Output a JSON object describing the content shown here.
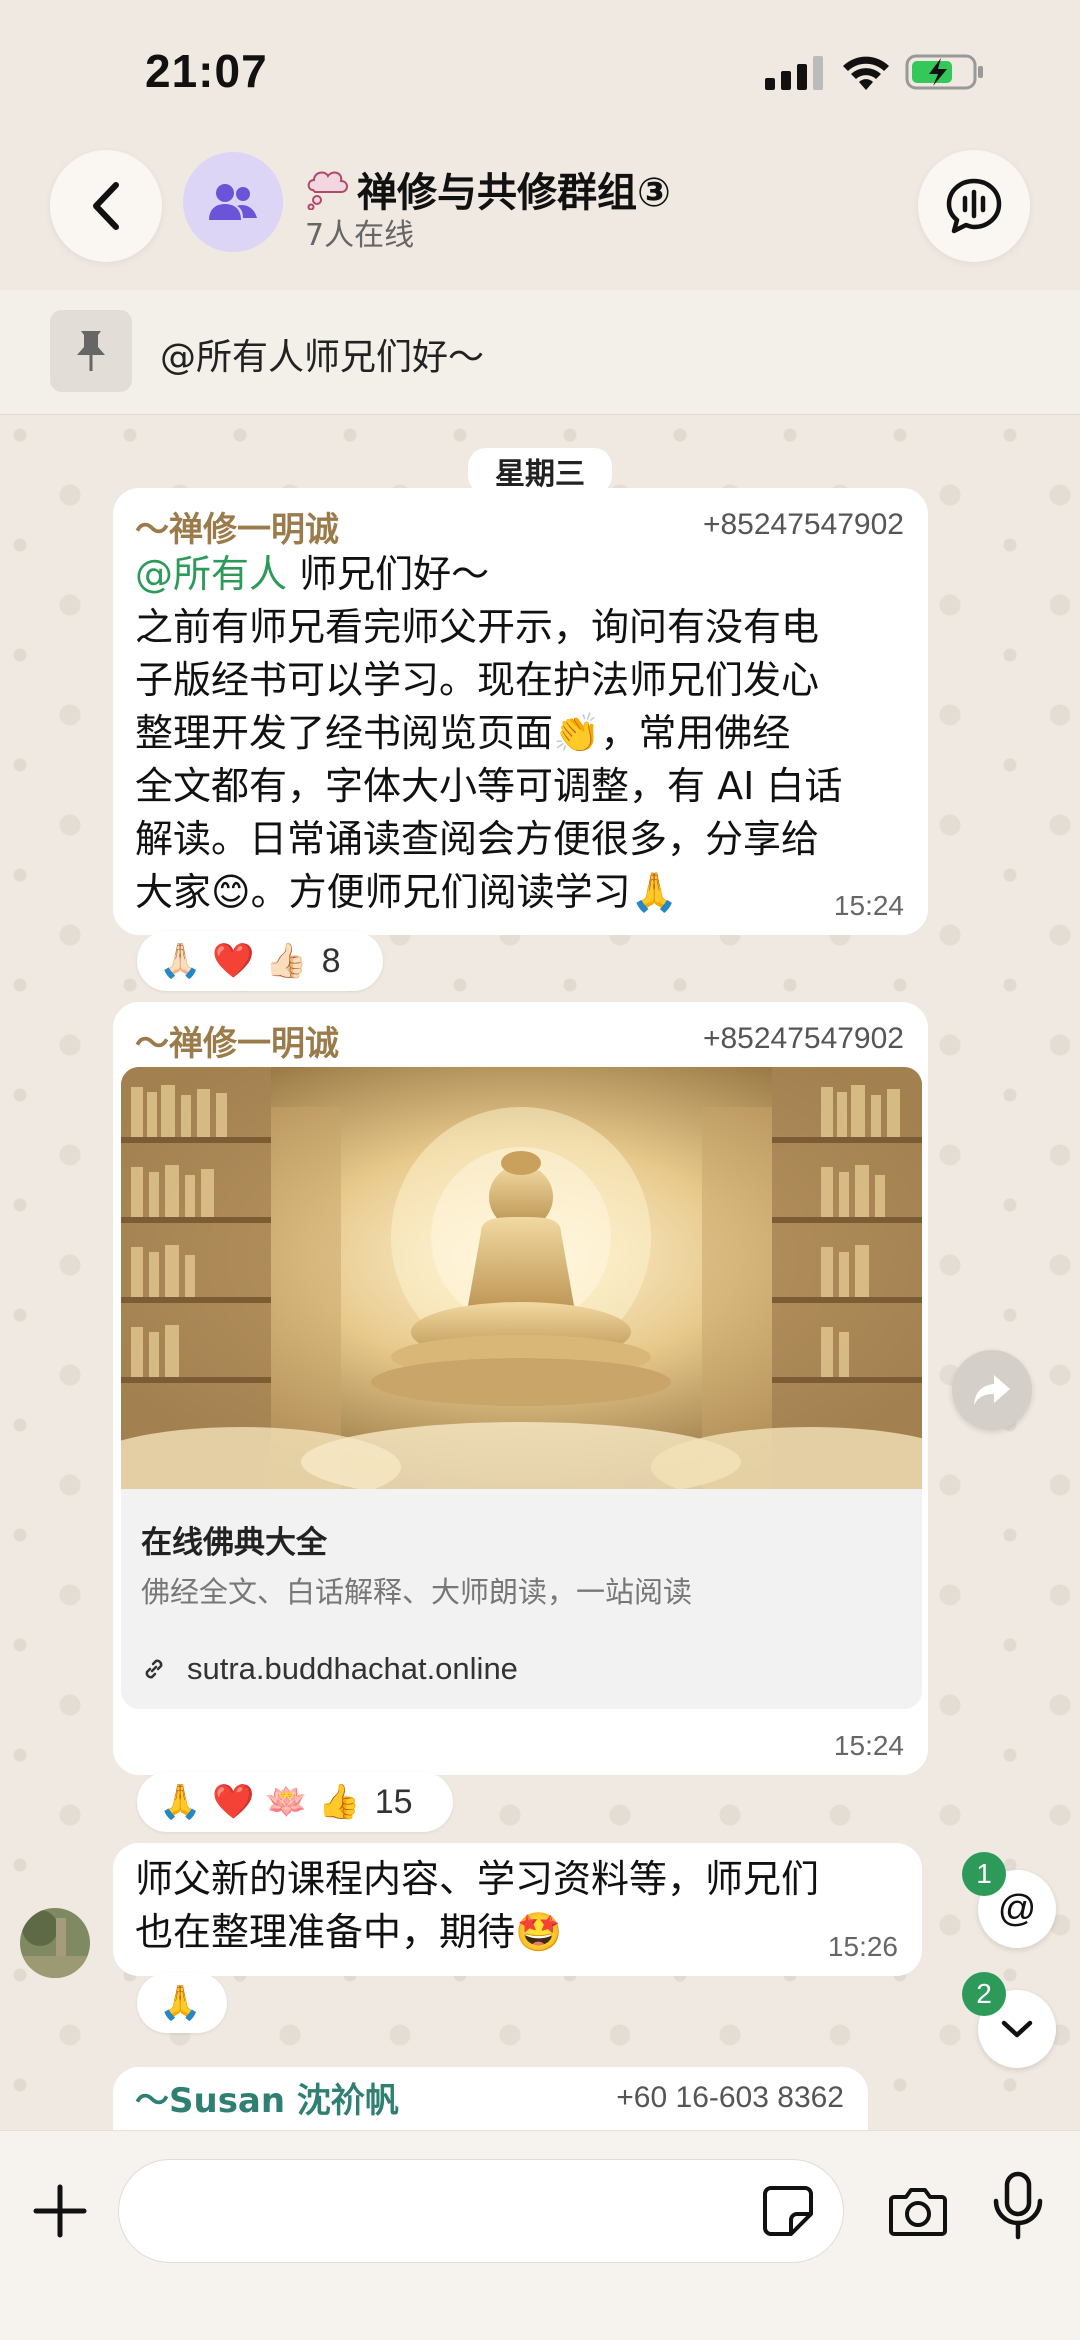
{
  "status_bar": {
    "time": "21:07"
  },
  "header": {
    "title": "禅修与共修群组③",
    "subtitle": "7人在线"
  },
  "pinned": {
    "text": "@所有人师兄们好～"
  },
  "day_label": "星期三",
  "messages": [
    {
      "sender": "～禅修一明诚",
      "phone": "+85247547902",
      "mention": "@所有人",
      "greeting": " 师兄们好～",
      "lines": [
        "之前有师兄看完师父开示，询问有没有电",
        "子版经书可以学习。现在护法师兄们发心",
        "整理开发了经书阅览页面👏，常用佛经",
        "全文都有，字体大小等可调整，有 AI 白话",
        "解读。日常诵读查阅会方便很多，分享给",
        "大家😊。方便师兄们阅读学习🙏"
      ],
      "time": "15:24",
      "reactions": {
        "emojis": "🙏🏻 ❤️ 👍🏻",
        "count": "8"
      }
    },
    {
      "sender": "～禅修一明诚",
      "phone": "+85247547902",
      "link_card": {
        "title": "在线佛典大全",
        "description": "佛经全文、白话解释、大师朗读，一站阅读",
        "url": "sutra.buddhachat.online"
      },
      "time": "15:24",
      "reactions": {
        "emojis": "🙏 ❤️ 🪷 👍",
        "count": "15"
      }
    },
    {
      "lines": [
        "师父新的课程内容、学习资料等，师兄们",
        "也在整理准备中，期待🤩"
      ],
      "time": "15:26",
      "reactions": {
        "emojis": "🙏"
      }
    },
    {
      "sender": "～Susan 沈祄帆",
      "phone": "+60 16-603 8362"
    }
  ],
  "side_buttons": {
    "mention_badge": "1",
    "mention_label": "@",
    "scroll_badge": "2"
  },
  "colors": {
    "accent_green": "#2e9a5a",
    "sender_gold": "#9b7b4a",
    "sender_teal": "#2f7f73",
    "chat_bg": "#efe9e1"
  },
  "icons": [
    "back-icon",
    "group-icon",
    "voice-chat-icon",
    "pin-icon",
    "forward-icon",
    "plus-icon",
    "sticker-icon",
    "camera-icon",
    "microphone-icon",
    "link-icon",
    "chevron-down-icon"
  ]
}
